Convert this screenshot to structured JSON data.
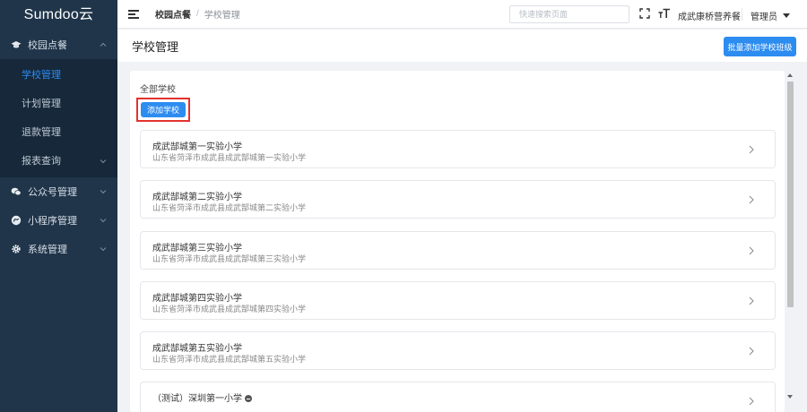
{
  "app": {
    "logo": "Sumdoo云"
  },
  "sidebar": {
    "groups": [
      {
        "label": "校园点餐",
        "icon": "graduation-cap-icon",
        "expanded": true,
        "items": [
          {
            "label": "学校管理",
            "active": true
          },
          {
            "label": "计划管理"
          },
          {
            "label": "退款管理"
          },
          {
            "label": "报表查询",
            "has_children": true
          }
        ]
      },
      {
        "label": "公众号管理",
        "icon": "wechat-icon"
      },
      {
        "label": "小程序管理",
        "icon": "mini-program-icon"
      },
      {
        "label": "系统管理",
        "icon": "gear-icon"
      }
    ]
  },
  "topbar": {
    "breadcrumb": [
      "校园点餐",
      "学校管理"
    ],
    "search_placeholder": "快速搜索页面",
    "shop_name": "成武康桥营养餐",
    "user": "管理员"
  },
  "page": {
    "title": "学校管理",
    "batch_button": "批量添加学校班级",
    "all_schools_label": "全部学校",
    "add_button": "添加学校",
    "schools": [
      {
        "name": "成武郜城第一实验小学",
        "address": "山东省菏泽市成武县成武郜城第一实验小学"
      },
      {
        "name": "成武郜城第二实验小学",
        "address": "山东省菏泽市成武县成武郜城第二实验小学"
      },
      {
        "name": "成武郜城第三实验小学",
        "address": "山东省菏泽市成武县成武郜城第三实验小学"
      },
      {
        "name": "成武郜城第四实验小学",
        "address": "山东省菏泽市成武县成武郜城第四实验小学"
      },
      {
        "name": "成武郜城第五实验小学",
        "address": "山东省菏泽市成武县成武郜城第五实验小学"
      },
      {
        "name": "（测试）深圳第一小学",
        "address": ""
      }
    ]
  },
  "colors": {
    "sidebar_bg": "#20354a",
    "primary": "#2d8cf0",
    "highlight": "#e3322d"
  }
}
